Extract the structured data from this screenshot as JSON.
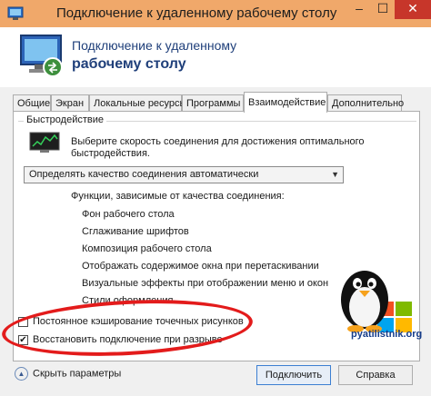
{
  "window": {
    "title": "Подключение к удаленному рабочему столу",
    "controls": {
      "minimize": "‒",
      "maximize": "☐",
      "close": "✕"
    }
  },
  "header": {
    "title_line1": "Подключение к удаленному",
    "title_line2": "рабочему столу"
  },
  "tabs": [
    {
      "label": "Общие"
    },
    {
      "label": "Экран"
    },
    {
      "label": "Локальные ресурсы"
    },
    {
      "label": "Программы"
    },
    {
      "label": "Взаимодействие",
      "active": true
    },
    {
      "label": "Дополнительно"
    }
  ],
  "performance": {
    "group_label": "Быстродействие",
    "description": "Выберите скорость соединения для достижения оптимального быстродействия.",
    "select_value": "Определять качество соединения автоматически",
    "features_title": "Функции, зависимые от качества соединения:",
    "features": [
      "Фон рабочего стола",
      "Сглаживание шрифтов",
      "Композиция рабочего стола",
      "Отображать содержимое окна при перетаскивании",
      "Визуальные эффекты при отображении меню и окон",
      "Стили оформления"
    ]
  },
  "checkboxes": [
    {
      "label": "Постоянное кэширование точечных рисунков",
      "checked": false
    },
    {
      "label": "Восстановить подключение при разрыве",
      "checked": true
    }
  ],
  "footer": {
    "options_label": "Скрыть параметры",
    "connect_label": "Подключить",
    "help_label": "Справка"
  },
  "watermark": {
    "text": "pyatilistnik.org"
  },
  "colors": {
    "titlebar": "#f0a86a",
    "close_button": "#c7362a",
    "header_text": "#1f3f7a",
    "highlight_ellipse": "#e31b1b"
  }
}
